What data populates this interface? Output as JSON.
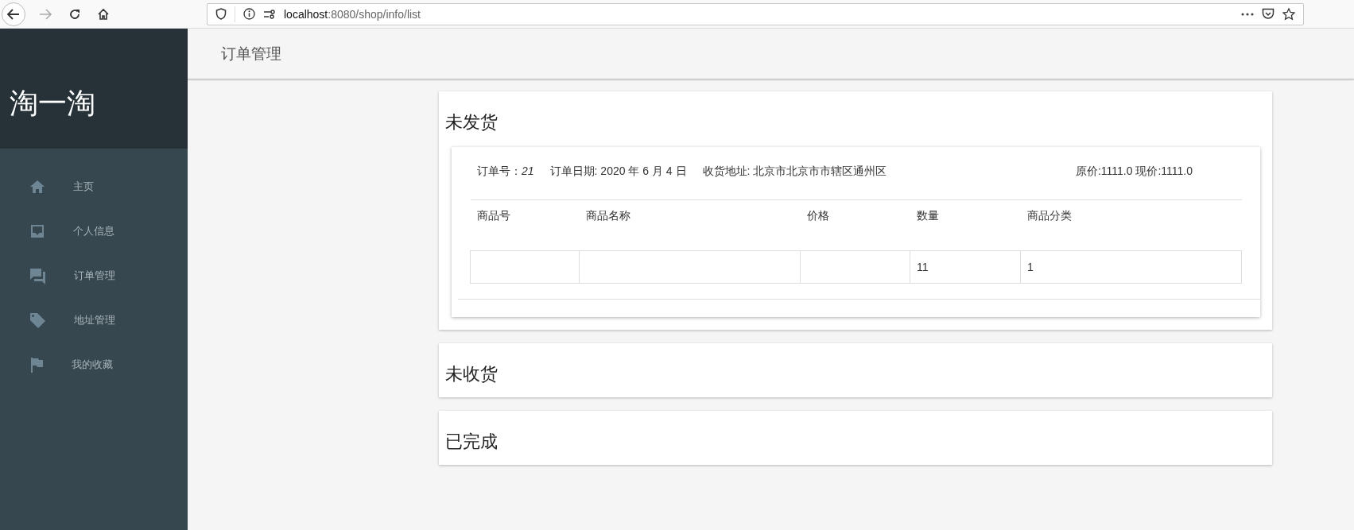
{
  "browser": {
    "url_host": "localhost",
    "url_path": ":8080/shop/info/list"
  },
  "sidebar": {
    "logo": "淘一淘",
    "items": [
      {
        "label": "主页"
      },
      {
        "label": "个人信息"
      },
      {
        "label": "订单管理"
      },
      {
        "label": "地址管理"
      },
      {
        "label": "我的收藏"
      }
    ]
  },
  "header": {
    "title": "订单管理"
  },
  "sections": [
    {
      "title": "未发货",
      "orders": [
        {
          "number": "订单号：*21*",
          "date": "订单日期: 2020 年 6 月 4 日",
          "address": "收货地址: 北京市北京市市辖区通州区",
          "prices": "原价:1111.0 现价:1111.0",
          "columns": [
            "商品号",
            "商品名称",
            "价格",
            "数量",
            "商品分类"
          ],
          "rows": [
            {
              "quantity": "11",
              "category": "1"
            }
          ]
        }
      ]
    },
    {
      "title": "未收货"
    },
    {
      "title": "已完成"
    }
  ]
}
